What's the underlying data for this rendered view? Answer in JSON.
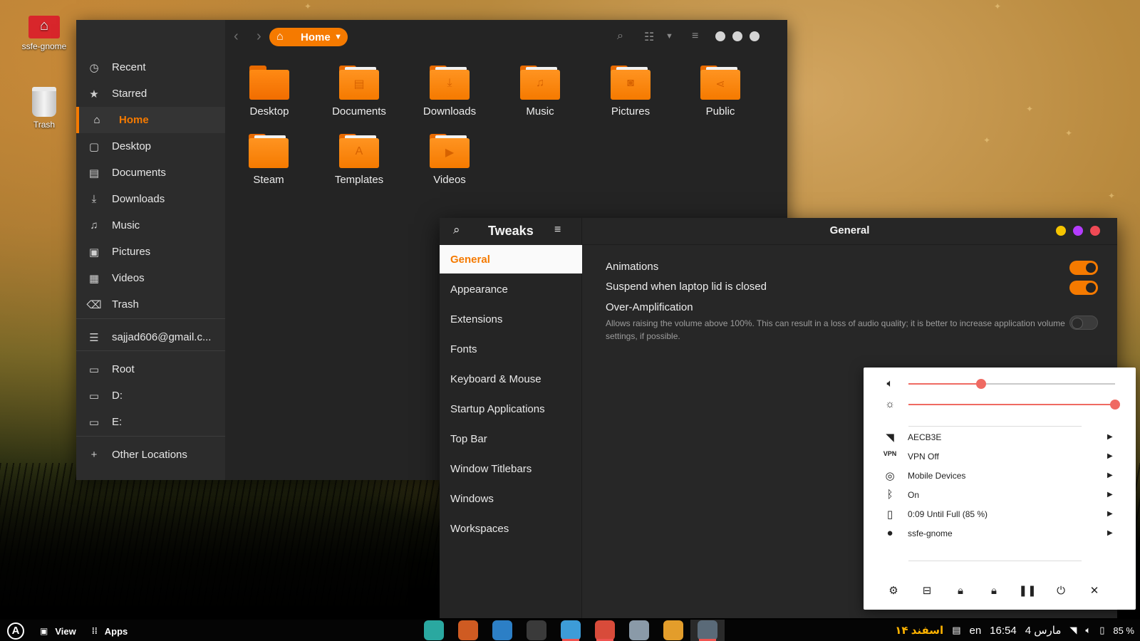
{
  "desktop": {
    "icons": [
      {
        "label": "ssfe-gnome",
        "icon": "home-folder-icon"
      },
      {
        "label": "Trash",
        "icon": "trash-icon"
      }
    ]
  },
  "files": {
    "path_label": "Home",
    "sidebar": [
      {
        "label": "Recent",
        "icon": "clock-icon"
      },
      {
        "label": "Starred",
        "icon": "star-icon"
      },
      {
        "label": "Home",
        "icon": "home-icon",
        "active": true
      },
      {
        "label": "Desktop",
        "icon": "desktop-icon"
      },
      {
        "label": "Documents",
        "icon": "documents-icon"
      },
      {
        "label": "Downloads",
        "icon": "download-icon"
      },
      {
        "label": "Music",
        "icon": "music-icon"
      },
      {
        "label": "Pictures",
        "icon": "pictures-icon"
      },
      {
        "label": "Videos",
        "icon": "videos-icon"
      },
      {
        "label": "Trash",
        "icon": "trash-icon"
      },
      {
        "label": "sajjad606@gmail.c...",
        "icon": "network-drive-icon"
      },
      {
        "label": "Root",
        "icon": "folder-icon"
      },
      {
        "label": "D:",
        "icon": "folder-icon"
      },
      {
        "label": "E:",
        "icon": "folder-icon"
      },
      {
        "label": "Other Locations",
        "icon": "plus-icon"
      }
    ],
    "folders": [
      {
        "name": "Desktop",
        "icon": "desktop-folder-icon"
      },
      {
        "name": "Documents",
        "icon": "documents-folder-icon"
      },
      {
        "name": "Downloads",
        "icon": "downloads-folder-icon"
      },
      {
        "name": "Music",
        "icon": "music-folder-icon"
      },
      {
        "name": "Pictures",
        "icon": "pictures-folder-icon"
      },
      {
        "name": "Public",
        "icon": "public-folder-icon"
      },
      {
        "name": "Steam",
        "icon": "folder-icon"
      },
      {
        "name": "Templates",
        "icon": "templates-folder-icon"
      },
      {
        "name": "Videos",
        "icon": "videos-folder-icon"
      }
    ]
  },
  "tweaks": {
    "title": "Tweaks",
    "heading": "General",
    "categories": [
      "General",
      "Appearance",
      "Extensions",
      "Fonts",
      "Keyboard & Mouse",
      "Startup Applications",
      "Top Bar",
      "Window Titlebars",
      "Windows",
      "Workspaces"
    ],
    "active_category": "General",
    "settings": [
      {
        "label": "Animations",
        "enabled": true
      },
      {
        "label": "Suspend when laptop lid is closed",
        "enabled": true
      },
      {
        "label": "Over-Amplification",
        "enabled": false,
        "description": "Allows raising the volume above 100%. This can result in a loss of audio quality; it is better to increase application volume settings, if possible."
      }
    ],
    "window_controls": {
      "minimize": "#f5c400",
      "maximize": "#b43cff",
      "close": "#ef4a55"
    }
  },
  "quick_settings": {
    "volume_level": 0.35,
    "brightness_level": 1.0,
    "items": [
      {
        "label": "AECB3E",
        "icon": "wifi-icon"
      },
      {
        "label": "VPN Off",
        "icon": "vpn-icon"
      },
      {
        "label": "Mobile Devices",
        "icon": "mobile-devices-icon"
      },
      {
        "label": "On",
        "icon": "bluetooth-icon"
      },
      {
        "label": "0:09 Until Full (85 %)",
        "icon": "battery-icon"
      },
      {
        "label": "ssfe-gnome",
        "icon": "user-icon"
      }
    ],
    "actions": [
      "settings",
      "screen-layout",
      "lock-orientation",
      "lock",
      "suspend",
      "power",
      "close"
    ]
  },
  "panel": {
    "view_label": "View",
    "apps_label": "Apps",
    "date": "۱۴ اسفند",
    "lang": "en",
    "time": "16:54",
    "date2": "مارس 4",
    "battery": "85 %",
    "dock": [
      {
        "name": "maps",
        "color": "#2aa8a0",
        "running": false
      },
      {
        "name": "color-picker",
        "color": "#cf5b22",
        "running": false
      },
      {
        "name": "text-editor",
        "color": "#2c7fc6",
        "running": false
      },
      {
        "name": "terminal",
        "color": "#3a3a3a",
        "running": false
      },
      {
        "name": "finder",
        "color": "#3d9cd8",
        "running": true
      },
      {
        "name": "chrome-dev",
        "color": "#d84b3a",
        "running": true
      },
      {
        "name": "settings",
        "color": "#8a9aa8",
        "running": false
      },
      {
        "name": "color-app",
        "color": "#e39d2b",
        "running": false
      },
      {
        "name": "droplet",
        "color": "#5a6a78",
        "running": true,
        "current": true
      }
    ]
  }
}
